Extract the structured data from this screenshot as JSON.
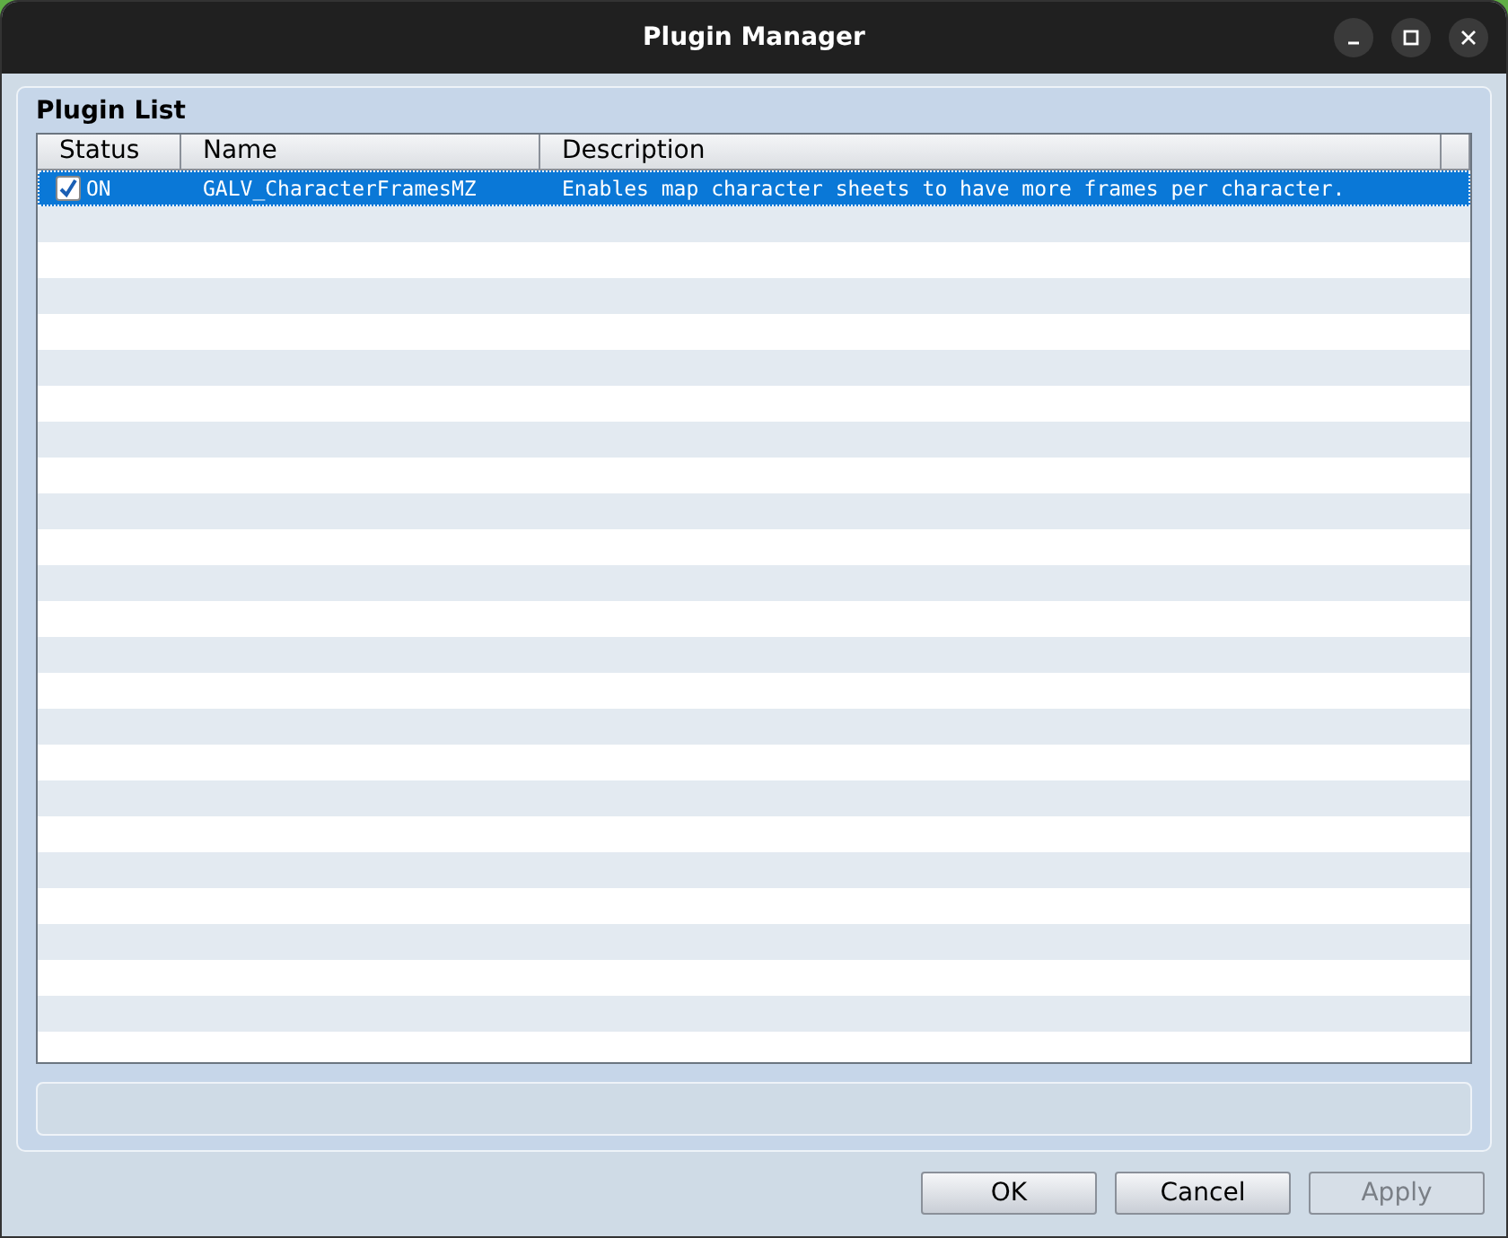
{
  "window": {
    "title": "Plugin Manager"
  },
  "group": {
    "title": "Plugin List"
  },
  "table": {
    "columns": [
      "Status",
      "Name",
      "Description"
    ],
    "rows": [
      {
        "checked": true,
        "status": "ON",
        "name": "GALV_CharacterFramesMZ",
        "description": "Enables map character sheets to have more frames per character.",
        "selected": true
      }
    ]
  },
  "buttons": [
    {
      "label": "OK",
      "disabled": false
    },
    {
      "label": "Cancel",
      "disabled": false
    },
    {
      "label": "Apply",
      "disabled": true
    }
  ]
}
